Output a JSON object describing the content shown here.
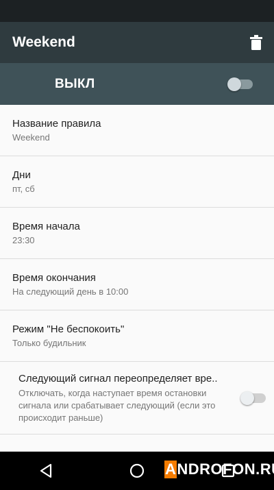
{
  "app_bar": {
    "title": "Weekend",
    "delete_icon": "trash-icon"
  },
  "master_switch": {
    "label": "ВЫКЛ",
    "state": "off"
  },
  "settings": [
    {
      "title": "Название правила",
      "subtitle": "Weekend"
    },
    {
      "title": "Дни",
      "subtitle": "пт, сб"
    },
    {
      "title": "Время начала",
      "subtitle": "23:30"
    },
    {
      "title": "Время окончания",
      "subtitle": "На следующий день в 10:00"
    },
    {
      "title": "Режим \"Не беспокоить\"",
      "subtitle": "Только будильник"
    }
  ],
  "alarm_override": {
    "title": "Следующий сигнал переопределяет вре..",
    "subtitle": "Отключать, когда наступает время остановки сигнала или срабатывает следующий (если это происходит раньше)",
    "state": "off"
  },
  "nav_bar": {
    "back_icon": "back-triangle-icon",
    "home_icon": "home-circle-icon",
    "recents_icon": "recents-square-icon"
  },
  "watermark": {
    "first_letter": "A",
    "rest": "NDROFON.RU"
  },
  "colors": {
    "status_bar": "#1c2123",
    "app_bar": "#2f3b3f",
    "master_bar": "#3f5258",
    "background": "#fafafa"
  }
}
